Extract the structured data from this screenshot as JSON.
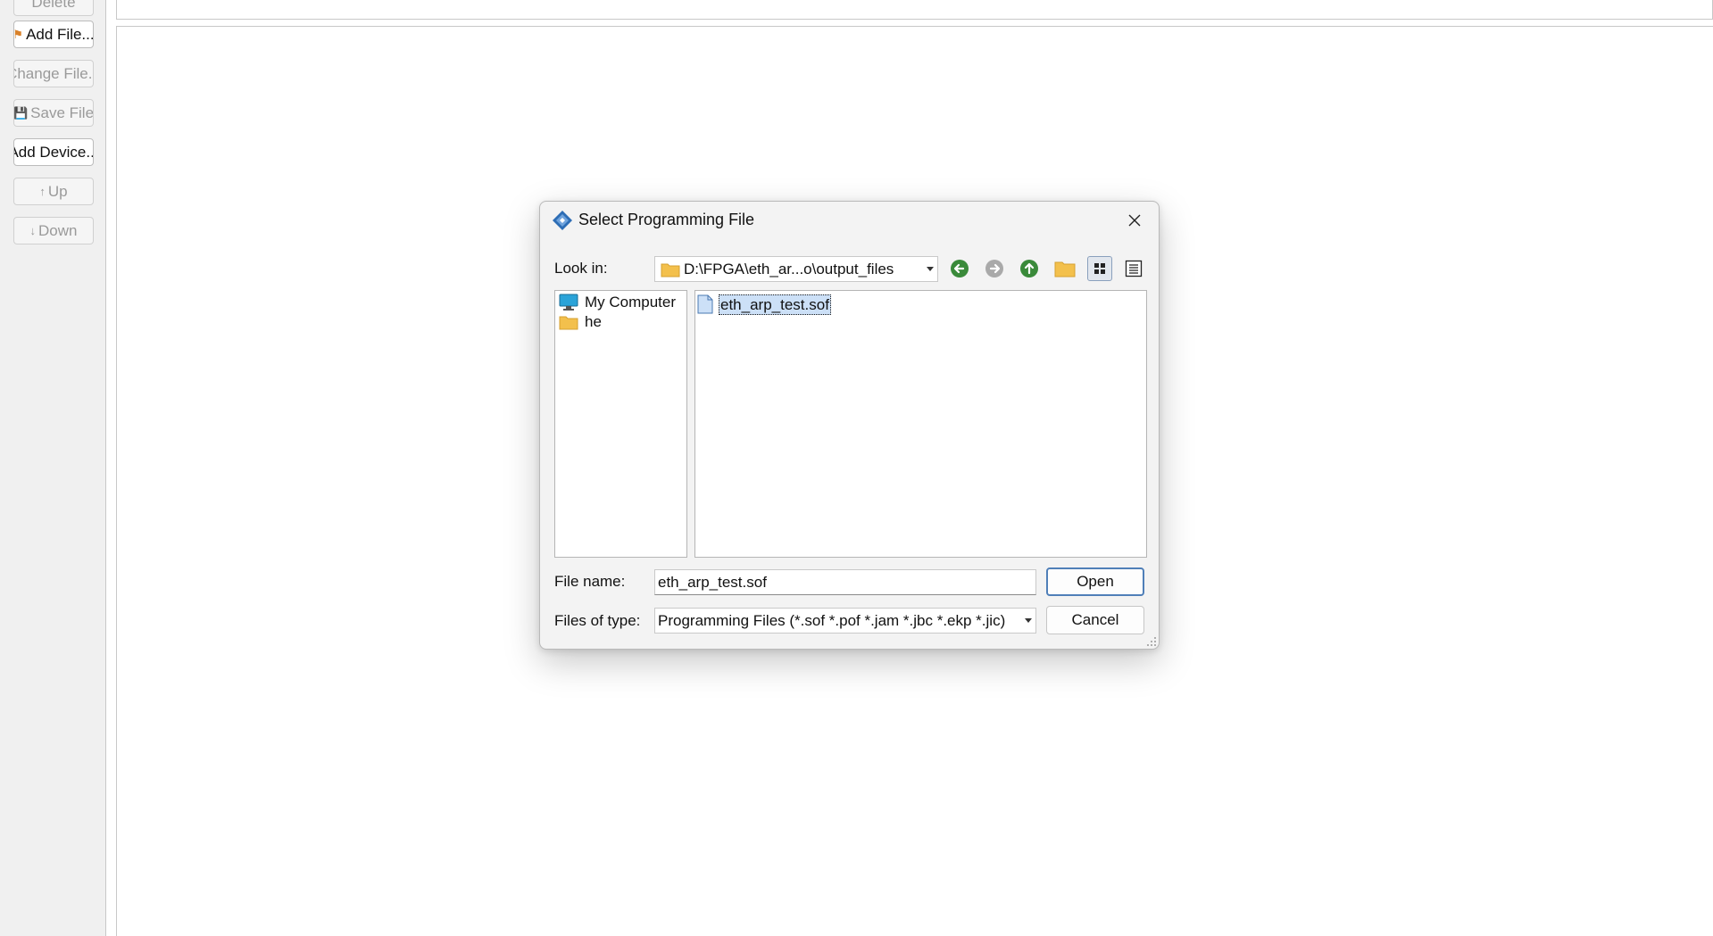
{
  "toolbar": {
    "items": [
      {
        "label": "Delete",
        "enabled": false,
        "icon": "delete-icon"
      },
      {
        "label": "Add File...",
        "enabled": true,
        "icon": "add-file-icon"
      },
      {
        "label": "Change File...",
        "enabled": false,
        "icon": ""
      },
      {
        "label": "Save File",
        "enabled": false,
        "icon": "save-file-icon"
      },
      {
        "label": "Add Device...",
        "enabled": true,
        "icon": ""
      },
      {
        "label": "Up",
        "enabled": false,
        "icon": "up-arrow-icon"
      },
      {
        "label": "Down",
        "enabled": false,
        "icon": "down-arrow-icon"
      }
    ]
  },
  "dialog": {
    "title": "Select Programming File",
    "look_in_label": "Look in:",
    "look_in_value": "D:\\FPGA\\eth_ar...o\\output_files",
    "toolbar_icons": [
      "back-icon",
      "forward-icon",
      "parent-directory-icon",
      "new-folder-icon",
      "list-view-icon",
      "detail-view-icon"
    ],
    "places": [
      {
        "label": "My Computer",
        "icon": "computer-icon"
      },
      {
        "label": "he",
        "icon": "folder-icon"
      }
    ],
    "files": [
      {
        "label": "eth_arp_test.sof",
        "icon": "file-icon",
        "selected": true
      }
    ],
    "file_name_label": "File name:",
    "file_name_value": "eth_arp_test.sof",
    "files_of_type_label": "Files of type:",
    "files_of_type_value": "Programming Files (*.sof *.pof *.jam *.jbc *.ekp *.jic)",
    "open_label": "Open",
    "cancel_label": "Cancel"
  },
  "colors": {
    "accent_blue": "#4f7fb8",
    "selection": "#cce0f7",
    "nav_green": "#3a8a3a",
    "folder_yellow": "#f3c04c"
  }
}
